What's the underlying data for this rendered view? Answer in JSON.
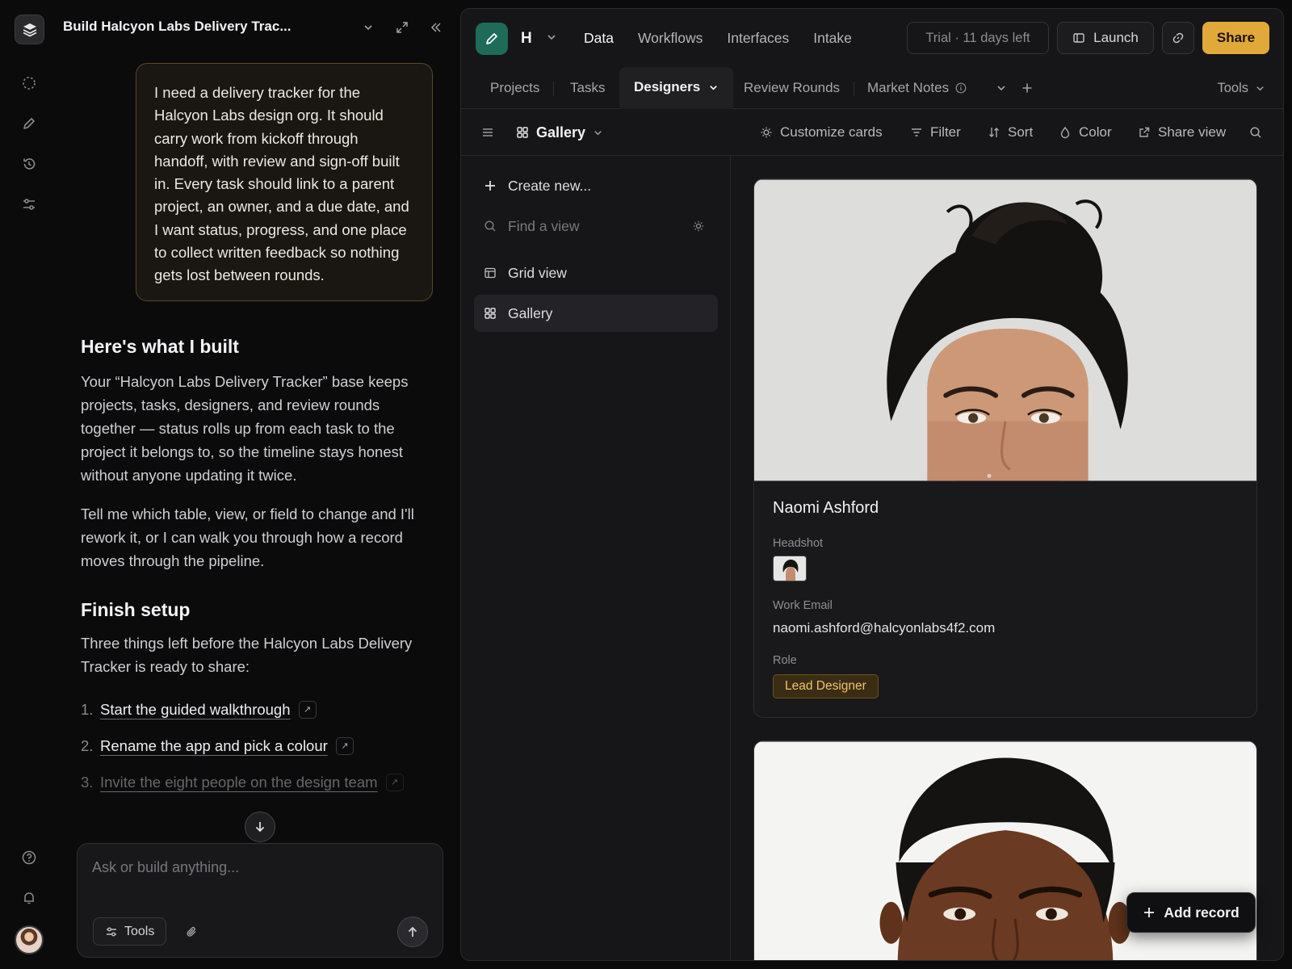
{
  "chat": {
    "title": "Build Halcyon Labs Delivery Trac...",
    "user_message": "I need a delivery tracker for the Halcyon Labs design org. It should carry work from kickoff through handoff, with review and sign-off built in. Every task should link to a parent project, an owner, and a due date, and I want status, progress, and one place to collect written feedback so nothing gets lost between rounds.",
    "built_heading": "Here's what I built",
    "built_para1": "Your “Halcyon Labs Delivery Tracker” base keeps projects, tasks, designers, and review rounds together — status rolls up from each task to the project it belongs to, so the timeline stays honest without anyone updating it twice.",
    "built_para2": "Tell me which table, view, or field to change and I'll rework it, or I can walk you through how a record moves through the pipeline.",
    "setup_heading": "Finish setup",
    "setup_intro": "Three things left before the Halcyon Labs Delivery Tracker is ready to share:",
    "steps": [
      {
        "num": "1.",
        "label": "Start the guided walkthrough"
      },
      {
        "num": "2.",
        "label": "Rename the app and pick a colour"
      },
      {
        "num": "3.",
        "label": "Invite the eight people on the design team"
      }
    ],
    "composer_placeholder": "Ask or build anything...",
    "tools_label": "Tools"
  },
  "app": {
    "letter": "H",
    "nav": [
      "Data",
      "Workflows",
      "Interfaces",
      "Intake"
    ],
    "trial": "Trial · 11 days left",
    "launch": "Launch",
    "share": "Share",
    "tabs": [
      "Projects",
      "Tasks",
      "Designers",
      "Review Rounds",
      "Market Notes"
    ],
    "tools": "Tools",
    "view_name": "Gallery",
    "toolbar": {
      "customize": "Customize cards",
      "filter": "Filter",
      "sort": "Sort",
      "color": "Color",
      "share_view": "Share view"
    },
    "sidebar": {
      "create": "Create new...",
      "find_placeholder": "Find a view",
      "views": [
        "Grid view",
        "Gallery"
      ]
    },
    "cards": [
      {
        "name": "Naomi Ashford",
        "headshot_label": "Headshot",
        "email_label": "Work Email",
        "email": "naomi.ashford@halcyonlabs4f2.com",
        "role_label": "Role",
        "role": "Lead Designer"
      }
    ],
    "add_record": "Add record"
  },
  "colors": {
    "accent": "#e0a93a",
    "app_icon": "#1f6b5a",
    "role_pill_text": "#f0c46a"
  }
}
